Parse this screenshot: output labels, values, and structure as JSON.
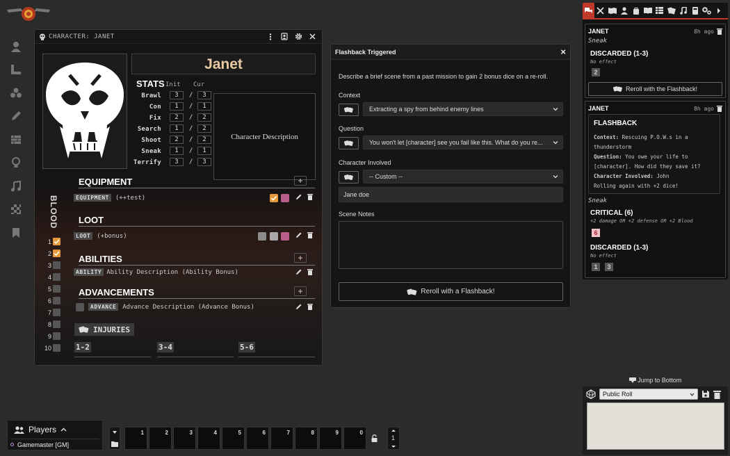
{
  "sheet": {
    "title": "CHARACTER: JANET",
    "name": "Janet",
    "stats_title": "STATS",
    "init_label": "Init",
    "cur_label": "Cur",
    "stats": [
      {
        "label": "Brawl",
        "init": "3",
        "cur": "3"
      },
      {
        "label": "Con",
        "init": "1",
        "cur": "1"
      },
      {
        "label": "Fix",
        "init": "2",
        "cur": "2"
      },
      {
        "label": "Search",
        "init": "1",
        "cur": "2"
      },
      {
        "label": "Shoot",
        "init": "2",
        "cur": "2"
      },
      {
        "label": "Sneak",
        "init": "1",
        "cur": "1"
      },
      {
        "label": "Terrify",
        "init": "3",
        "cur": "3"
      }
    ],
    "description": "Character Description",
    "blood_label": "BLOOD",
    "blood": [
      {
        "n": "1",
        "checked": true
      },
      {
        "n": "2",
        "checked": true
      },
      {
        "n": "3",
        "checked": false
      },
      {
        "n": "4",
        "checked": false
      },
      {
        "n": "5",
        "checked": false
      },
      {
        "n": "6",
        "checked": false
      },
      {
        "n": "7",
        "checked": false
      },
      {
        "n": "8",
        "checked": false
      },
      {
        "n": "9",
        "checked": false
      },
      {
        "n": "10",
        "checked": false
      }
    ],
    "equipment_title": "EQUIPMENT",
    "equipment_tag": "EQUIPMENT",
    "equipment_text": "(++test)",
    "loot_title": "LOOT",
    "loot_tag": "LOOT",
    "loot_text": "(+bonus)",
    "abilities_title": "ABILITIES",
    "ability_tag": "ABILITY",
    "ability_text": "Ability Description (Ability Bonus)",
    "advancements_title": "ADVANCEMENTS",
    "advance_tag": "ADVANCE",
    "advance_text": "Advance Description (Advance Bonus)",
    "injuries_title": "INJURIES",
    "injury_ranges": [
      "1-2",
      "3-4",
      "5-6"
    ],
    "plus": "+"
  },
  "flashback": {
    "title": "Flashback Triggered",
    "intro": "Describe a brief scene from a past mission to gain 2 bonus dice on a re-roll.",
    "context_label": "Context",
    "context_value": "Extracting a spy from behind enemy lines",
    "question_label": "Question",
    "question_value": "You won't let [character] see you fail like this. What do you re...",
    "character_label": "Character Involved",
    "character_value": "-- Custom --",
    "custom_name": "Jane doe",
    "notes_label": "Scene Notes",
    "button": "Reroll with a Flashback!",
    "close": "×"
  },
  "chat": {
    "msg1": {
      "name": "JANET",
      "time": "8h ago",
      "stat": "Sneak",
      "result": "DISCARDED (1-3)",
      "effect": "No effect",
      "dice": [
        "2"
      ],
      "button": "Reroll with the Flashback!"
    },
    "msg2": {
      "name": "JANET",
      "time": "8h ago",
      "fb_title": "FLASHBACK",
      "context_k": "Context:",
      "context_v": "Rescuing P.O.W.s in a thunderstorm",
      "question_k": "Question:",
      "question_v": "You owe your life to [character]. How did they save it?",
      "char_k": "Character Involved:",
      "char_v": "John",
      "rolling": "Rolling again with +2 dice!",
      "stat": "Sneak",
      "critical": "CRITICAL (6)",
      "critical_effect": "+2 damage OR +2 defense OR +2 Blood",
      "critical_dice": [
        "6"
      ],
      "discarded": "DISCARDED (1-3)",
      "discarded_effect": "No effect",
      "discarded_dice": [
        "1",
        "3"
      ]
    },
    "jump": "Jump to Bottom",
    "roll_mode": "Public Roll"
  },
  "players": {
    "title": "Players",
    "gm": "Gamemaster [GM]"
  },
  "hotbar": {
    "slots": [
      "1",
      "2",
      "3",
      "4",
      "5",
      "6",
      "7",
      "8",
      "9",
      "0"
    ],
    "page": "1"
  },
  "colors": {
    "accent": "#c0392b",
    "orange": "#e59a3a",
    "pink": "#b85c8a",
    "name": "#e8c9a0"
  }
}
